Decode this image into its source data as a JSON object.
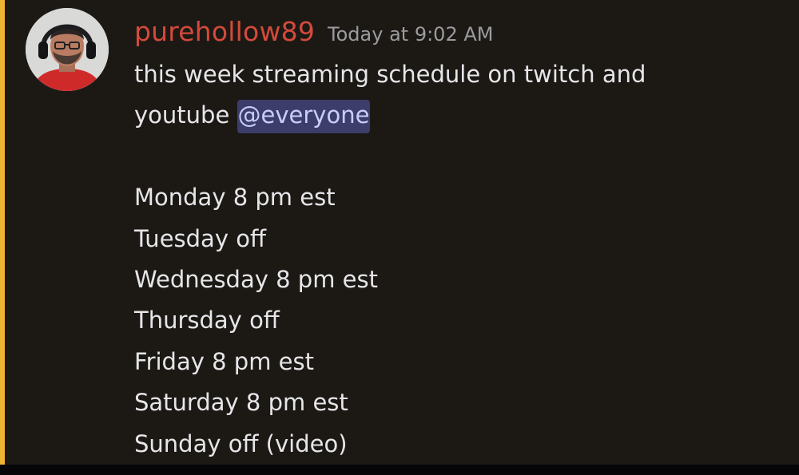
{
  "message": {
    "username": "purehollow89",
    "timestamp": "Today at 9:02 AM",
    "intro_line1": "this week streaming schedule on twitch and",
    "intro_line2": "youtube ",
    "mention": "@everyone",
    "schedule": [
      "Monday 8 pm est",
      "Tuesday off",
      "Wednesday 8 pm est",
      "Thursday off",
      "Friday 8 pm est",
      "Saturday 8 pm est",
      "Sunday off (video)"
    ]
  },
  "colors": {
    "username": "#d44a3c",
    "timestamp": "#9b9b9f",
    "message_text": "#e6e6e9",
    "mention_bg": "#3c3d6a",
    "mention_text": "#c9cdfb",
    "highlight_stripe": "#efb233",
    "background": "#1c1915"
  },
  "icons": {
    "avatar": "user-avatar-with-headphones"
  }
}
